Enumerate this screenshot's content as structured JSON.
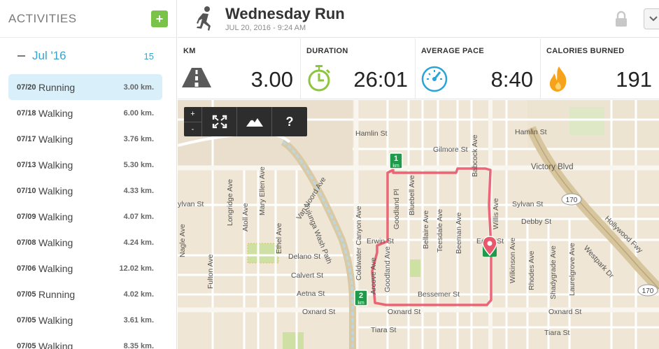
{
  "sidebar": {
    "title": "ACTIVITIES",
    "add_label": "+",
    "month_label": "Jul '16",
    "month_count": "15",
    "activities": [
      {
        "date": "07/20",
        "type": "Running",
        "distance": "3.00 km."
      },
      {
        "date": "07/18",
        "type": "Walking",
        "distance": "6.00 km."
      },
      {
        "date": "07/17",
        "type": "Walking",
        "distance": "3.76 km."
      },
      {
        "date": "07/13",
        "type": "Walking",
        "distance": "5.30 km."
      },
      {
        "date": "07/10",
        "type": "Walking",
        "distance": "4.33 km."
      },
      {
        "date": "07/09",
        "type": "Walking",
        "distance": "4.07 km."
      },
      {
        "date": "07/08",
        "type": "Walking",
        "distance": "4.24 km."
      },
      {
        "date": "07/06",
        "type": "Walking",
        "distance": "12.02 km."
      },
      {
        "date": "07/05",
        "type": "Running",
        "distance": "4.02 km."
      },
      {
        "date": "07/05",
        "type": "Walking",
        "distance": "3.61 km."
      },
      {
        "date": "07/05",
        "type": "Walking",
        "distance": "8.35 km."
      }
    ]
  },
  "header": {
    "title": "Wednesday Run",
    "subtitle": "JUL 20, 2016  -  9:24 AM"
  },
  "stats": {
    "km": {
      "label": "KM",
      "value": "3.00"
    },
    "duration": {
      "label": "DURATION",
      "value": "26:01"
    },
    "pace": {
      "label": "AVERAGE PACE",
      "value": "8:40"
    },
    "calories": {
      "label": "CALORIES BURNED",
      "value": "191"
    }
  },
  "map": {
    "zoom_in": "+",
    "zoom_out": "-",
    "help": "?",
    "marker_1": "1",
    "marker_2": "2",
    "marker_unit": "km",
    "streets": {
      "hamlin_w": "Hamlin St",
      "hamlin_e": "Hamlin St",
      "gilmore": "Gilmore St",
      "victory": "Victory Blvd",
      "sylvan_w": "ylvan St",
      "sylvan_e": "Sylvan St",
      "debby": "Debby St",
      "erwin": "Erwin St",
      "erwin_e": "Erwin St",
      "delano": "Delano St",
      "calvert": "Calvert St",
      "aetna": "Aetna St",
      "bessemer": "Bessemer St",
      "oxnard_w": "Oxnard St",
      "oxnard_c": "Oxnard St",
      "oxnard_e": "Oxnard St",
      "tiara_c": "Tiara St",
      "tiara_e": "Tiara St",
      "westpark": "Westpark Dr",
      "hollywood": "Hollywood Fwy",
      "tujunga": "Tujunga Wash Path",
      "vannoord": "Van Noord Ave",
      "coldwater": "Coldwater Canyon Ave",
      "willis": "Willis Ave",
      "ethel": "Ethel Ave",
      "maryellen": "Mary Ellen Ave",
      "atoll": "Atoll Ave",
      "longridge": "Longridge Ave",
      "fulton": "Fulton Ave",
      "nagle": "Nagle Ave",
      "goodland_pl": "Goodland Pl",
      "goodland": "Goodland Ave",
      "bluebell": "Bluebell Ave",
      "bellaire": "Bellaire Ave",
      "teesdale": "Teesdale Ave",
      "beeman": "Beeman Ave",
      "babcock": "Babcock Ave",
      "wilkinson": "Wilkinson Ave",
      "rhodes": "Rhodes Ave",
      "shadygrade": "Shadygrade Ave",
      "laurelgrove": "Laurelgrove Ave",
      "arcove": "Arcove Ave",
      "hw170a": "170",
      "hw170b": "170"
    }
  },
  "colors": {
    "accent": "#3aa3c8",
    "add_button": "#79c349",
    "route": "#e8576a",
    "km_marker": "#1f9a4a",
    "duration_icon": "#8cc63f",
    "pace_icon": "#2aa3d8",
    "calories_icon": "#f6a21b"
  }
}
